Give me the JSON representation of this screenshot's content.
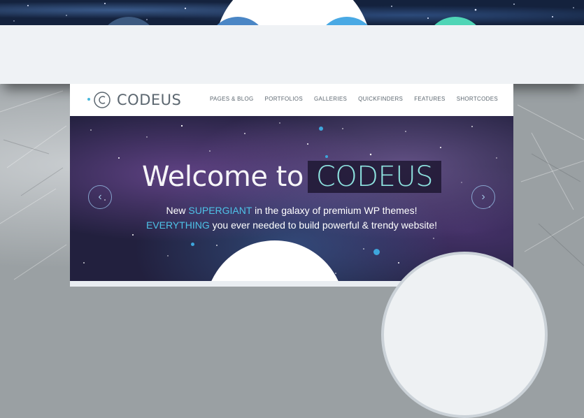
{
  "features": [
    {
      "icon": "shuffle-icon",
      "color": "#3d5a80"
    },
    {
      "icon": "smartphone-icon",
      "color": "#4a86c5"
    },
    {
      "icon": "sliders-icon",
      "color": "#49a9e4"
    },
    {
      "icon": "pencil-icon",
      "color": "#4fd5b6"
    }
  ],
  "site": {
    "logo": "CODEUS",
    "nav": [
      "PAGES & BLOG",
      "PORTFOLIOS",
      "GALLERIES",
      "QUICKFINDERS",
      "FEATURES",
      "SHORTCODES"
    ],
    "hero": {
      "title_pre": "Welcome to",
      "title_brand": "CODEUS",
      "line1_a": "New ",
      "line1_accent": "SUPERGIANT",
      "line1_b": " in the galaxy of premium WP themes!",
      "line2_accent": "EVERYTHING",
      "line2_b": " you ever needed to build powerful & trendy website!"
    }
  },
  "colors": {
    "accent": "#4ec3e8",
    "brand_teal": "#8ee3e0"
  }
}
